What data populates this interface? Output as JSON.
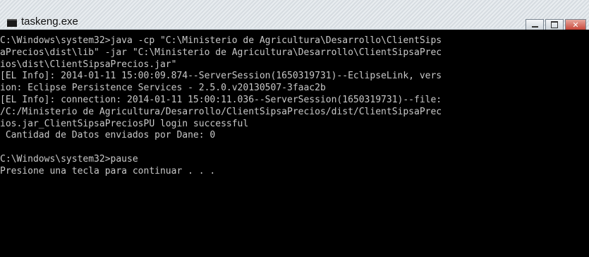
{
  "window": {
    "title": "taskeng.exe",
    "controls": {
      "minimize": "minimize-icon",
      "maximize": "maximize-icon",
      "close": "close-icon"
    }
  },
  "console": {
    "lines": [
      "C:\\Windows\\system32>java -cp \"C:\\Ministerio de Agricultura\\Desarrollo\\ClientSips",
      "aPrecios\\dist\\lib\" -jar \"C:\\Ministerio de Agricultura\\Desarrollo\\ClientSipsaPrec",
      "ios\\dist\\ClientSipsaPrecios.jar\"",
      "[EL Info]: 2014-01-11 15:00:09.874--ServerSession(1650319731)--EclipseLink, vers",
      "ion: Eclipse Persistence Services - 2.5.0.v20130507-3faac2b",
      "[EL Info]: connection: 2014-01-11 15:00:11.036--ServerSession(1650319731)--file:",
      "/C:/Ministerio de Agricultura/Desarrollo/ClientSipsaPrecios/dist/ClientSipsaPrec",
      "ios.jar_ClientSipsaPreciosPU login successful",
      " Cantidad de Datos enviados por Dane: 0",
      "",
      "C:\\Windows\\system32>pause",
      "Presione una tecla para continuar . . ."
    ]
  },
  "colors": {
    "console_background": "#000000",
    "console_text": "#c8c8c8",
    "close_button": "#c8473a"
  }
}
